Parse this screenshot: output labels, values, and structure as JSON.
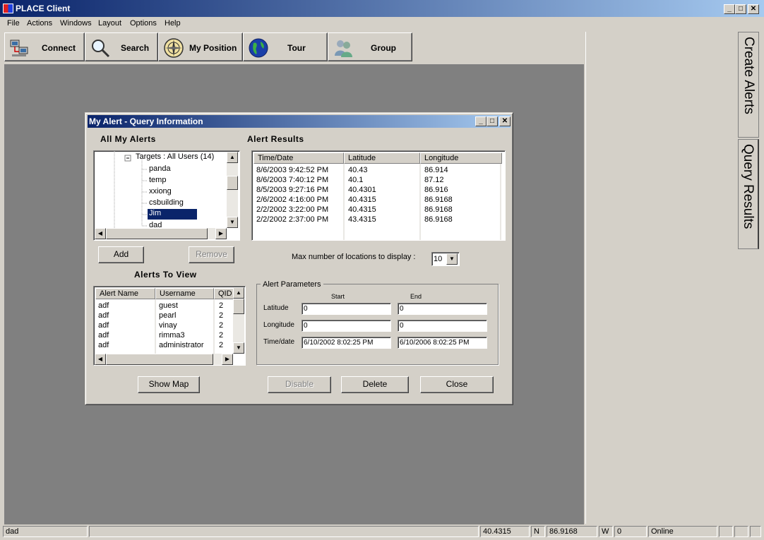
{
  "window": {
    "title": "PLACE Client"
  },
  "menu": [
    "File",
    "Actions",
    "Windows",
    "Layout",
    "Options",
    "Help"
  ],
  "toolbar": [
    {
      "label": "Connect",
      "icon": "computers-icon"
    },
    {
      "label": "Search",
      "icon": "magnifier-icon"
    },
    {
      "label": "My Position",
      "icon": "compass-icon"
    },
    {
      "label": "Tour",
      "icon": "globe-icon"
    },
    {
      "label": "Group",
      "icon": "people-icon"
    }
  ],
  "side_tabs": {
    "create_alerts": "Create Alerts",
    "query_results": "Query Results"
  },
  "dialog": {
    "title": "My Alert - Query Information",
    "all_alerts": {
      "heading": "All My Alerts",
      "tree_root": "Targets : All Users (14)",
      "tree_items": [
        "panda",
        "temp",
        "xxiong",
        "csbuilding",
        "Jim",
        "dad"
      ],
      "selected": "Jim"
    },
    "add_label": "Add",
    "remove_label": "Remove",
    "alerts_to_view": {
      "heading": "Alerts To View",
      "columns": [
        "Alert Name",
        "Username",
        "QID"
      ],
      "rows": [
        [
          "adf",
          "guest",
          "2"
        ],
        [
          "adf",
          "pearl",
          "2"
        ],
        [
          "adf",
          "vinay",
          "2"
        ],
        [
          "adf",
          "rimma3",
          "2"
        ],
        [
          "adf",
          "administrator",
          "2"
        ]
      ]
    },
    "show_map_label": "Show Map",
    "alert_results": {
      "heading": "Alert Results",
      "columns": [
        "Time/Date",
        "Latitude",
        "Longitude"
      ],
      "rows": [
        [
          "8/6/2003 9:42:52 PM",
          "40.43",
          "86.914"
        ],
        [
          "8/6/2003 7:40:12 PM",
          "40.1",
          "87.12"
        ],
        [
          "8/5/2003 9:27:16 PM",
          "40.4301",
          "86.916"
        ],
        [
          "2/6/2002 4:16:00 PM",
          "40.4315",
          "86.9168"
        ],
        [
          "2/2/2002 3:22:00 PM",
          "40.4315",
          "86.9168"
        ],
        [
          "2/2/2002 2:37:00 PM",
          "43.4315",
          "86.9168"
        ]
      ]
    },
    "max_locations": {
      "label": "Max number of locations to display :",
      "value": "10"
    },
    "params": {
      "legend": "Alert Parameters",
      "start_label": "Start",
      "end_label": "End",
      "latitude_label": "Latitude",
      "longitude_label": "Longitude",
      "timedate_label": "Time/date",
      "lat_start": "0",
      "lat_end": "0",
      "lon_start": "0",
      "lon_end": "0",
      "time_start": "6/10/2002 8:02:25 PM",
      "time_end": "6/10/2006 8:02:25 PM"
    },
    "disable_label": "Disable",
    "delete_label": "Delete",
    "close_label": "Close"
  },
  "status": {
    "user": "dad",
    "lat": "40.4315",
    "lat_dir": "N",
    "lon": "86.9168",
    "lon_dir": "W",
    "count": "0",
    "state": "Online"
  }
}
